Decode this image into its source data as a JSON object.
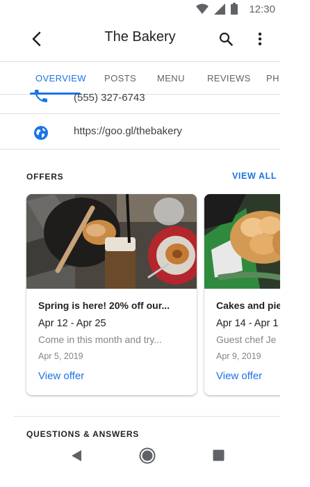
{
  "status_bar": {
    "time": "12:30",
    "icons": [
      "wifi-icon",
      "signal-icon",
      "battery-icon"
    ]
  },
  "app_bar": {
    "title": "The Bakery",
    "icons": [
      "back-arrow-icon",
      "search-icon",
      "more-vert-icon"
    ]
  },
  "tabs": [
    {
      "label": "OVERVIEW",
      "active": true
    },
    {
      "label": "POSTS",
      "active": false
    },
    {
      "label": "MENU",
      "active": false
    },
    {
      "label": "REVIEWS",
      "active": false
    },
    {
      "label": "PH",
      "active": false
    }
  ],
  "info": {
    "phone": "(555) 327-6743",
    "website": "https://goo.gl/thebakery"
  },
  "offers": {
    "title": "OFFERS",
    "view_all": "VIEW ALL",
    "cards": [
      {
        "title": "Spring is here! 20% off our...",
        "dates": "Apr 12 - Apr 25",
        "description": "Come in this month and try...",
        "posted": "Apr 5, 2019",
        "link": "View offer"
      },
      {
        "title": "Cakes and pie",
        "dates": "Apr 14 - Apr 1",
        "description": "Guest chef Je",
        "posted": "Apr 9, 2019",
        "link": "View offer"
      }
    ]
  },
  "questions": {
    "title": "QUESTIONS & ANSWERS"
  },
  "colors": {
    "accent": "#1a73e8",
    "text_primary": "#202124",
    "text_secondary": "#80868b",
    "divider": "#e0e0e0"
  }
}
